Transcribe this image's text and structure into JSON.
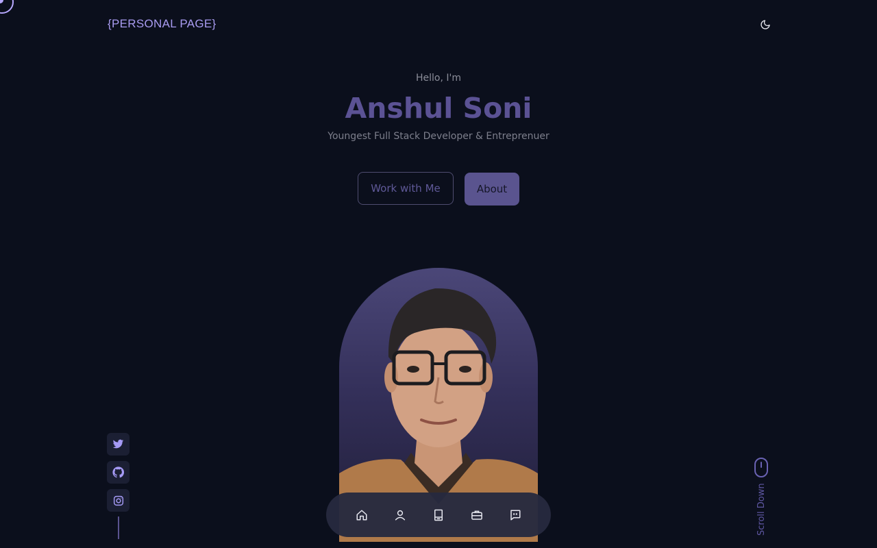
{
  "header": {
    "logo": "{PERSONAL PAGE}",
    "theme_icon": "moon-icon"
  },
  "hero": {
    "greeting": "Hello, I'm",
    "name": "Anshul Soni",
    "tagline": "Youngest Full Stack Developer & Entreprenuer",
    "primary_button": "Work with Me",
    "secondary_button": "About"
  },
  "socials": [
    {
      "icon": "twitter-icon"
    },
    {
      "icon": "github-icon"
    },
    {
      "icon": "instagram-icon"
    }
  ],
  "scroll": {
    "label": "Scroll Down",
    "icon": "mouse-icon"
  },
  "dock": [
    {
      "icon": "home-icon"
    },
    {
      "icon": "user-icon"
    },
    {
      "icon": "book-icon"
    },
    {
      "icon": "briefcase-icon"
    },
    {
      "icon": "message-icon"
    }
  ],
  "colors": {
    "background": "#0b0f1c",
    "accent": "#a89bf0",
    "name": "#5b5294",
    "dock": "#262a3e"
  }
}
